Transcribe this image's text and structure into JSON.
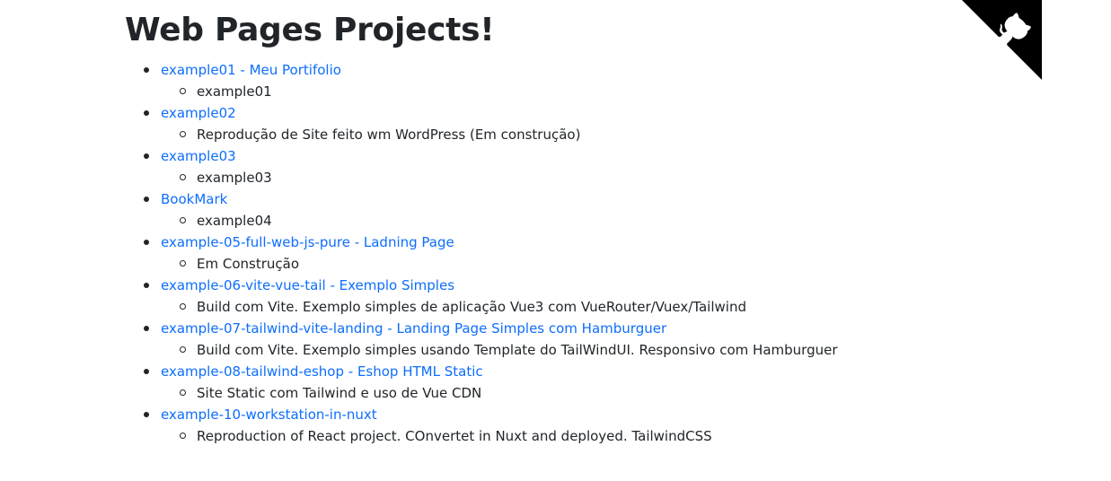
{
  "page": {
    "title": "Web Pages Projects!"
  },
  "projects": [
    {
      "link": "example01 - Meu Portifolio",
      "desc": "example01"
    },
    {
      "link": "example02",
      "desc": "Reprodução de Site feito wm WordPress (Em construção)"
    },
    {
      "link": "example03",
      "desc": "example03"
    },
    {
      "link": "BookMark",
      "desc": "example04"
    },
    {
      "link": "example-05-full-web-js-pure - Ladning Page",
      "desc": "Em Construção"
    },
    {
      "link": "example-06-vite-vue-tail - Exemplo Simples",
      "desc": "Build com Vite. Exemplo simples de aplicação Vue3 com VueRouter/Vuex/Tailwind"
    },
    {
      "link": "example-07-tailwind-vite-landing - Landing Page Simples com Hamburguer",
      "desc": "Build com Vite. Exemplo simples usando Template do TailWindUI. Responsivo com Hamburguer"
    },
    {
      "link": "example-08-tailwind-eshop - Eshop HTML Static",
      "desc": "Site Static com Tailwind e uso de Vue CDN"
    },
    {
      "link": "example-10-workstation-in-nuxt",
      "desc": "Reproduction of React project. COnvertet in Nuxt and deployed. TailwindCSS"
    }
  ],
  "corner": {
    "icon": "github-octocat-icon"
  },
  "colors": {
    "link": "#0d6efd",
    "text": "#212529",
    "corner": "#000000"
  }
}
